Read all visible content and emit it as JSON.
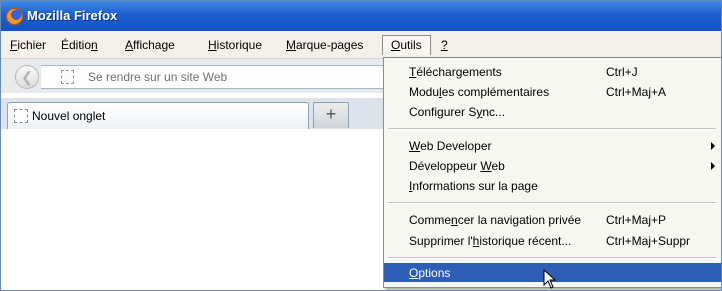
{
  "window": {
    "title": "Mozilla Firefox"
  },
  "menubar": [
    {
      "pre": "",
      "acc": "F",
      "post": "ichier"
    },
    {
      "pre": "Éditio",
      "acc": "n",
      "post": ""
    },
    {
      "pre": "",
      "acc": "A",
      "post": "ffichage"
    },
    {
      "pre": "",
      "acc": "H",
      "post": "istorique"
    },
    {
      "pre": "",
      "acc": "M",
      "post": "arque-pages"
    },
    {
      "pre": "",
      "acc": "O",
      "post": "utils"
    },
    {
      "pre": "",
      "acc": "?",
      "post": ""
    }
  ],
  "navbar": {
    "url_placeholder": "Se rendre sur un site Web"
  },
  "tabs": {
    "active_label": "Nouvel onglet",
    "new_tab_symbol": "+"
  },
  "tools_menu": {
    "items": [
      {
        "pre": "",
        "acc": "T",
        "post": "éléchargements",
        "shortcut": "Ctrl+J"
      },
      {
        "pre": "Modu",
        "acc": "l",
        "post": "es complémentaires",
        "shortcut": "Ctrl+Maj+A"
      },
      {
        "pre": "Configurer S",
        "acc": "y",
        "post": "nc...",
        "shortcut": ""
      },
      {
        "pre": "",
        "acc": "W",
        "post": "eb Developer",
        "shortcut": "",
        "submenu": true
      },
      {
        "pre": "Développeur ",
        "acc": "W",
        "post": "eb",
        "shortcut": "",
        "submenu": true
      },
      {
        "pre": "",
        "acc": "I",
        "post": "nformations sur la page",
        "shortcut": ""
      },
      {
        "pre": "Comme",
        "acc": "n",
        "post": "cer la navigation privée",
        "shortcut": "Ctrl+Maj+P"
      },
      {
        "pre": "Supprimer l'",
        "acc": "h",
        "post": "istorique récent...",
        "shortcut": "Ctrl+Maj+Suppr"
      },
      {
        "pre": "",
        "acc": "O",
        "post": "ptions",
        "shortcut": "",
        "highlighted": true
      }
    ]
  },
  "colors": {
    "titlebar": "#1d5fd0",
    "menu_highlight": "#2d5db5",
    "menubar": "#f2f0e8"
  }
}
